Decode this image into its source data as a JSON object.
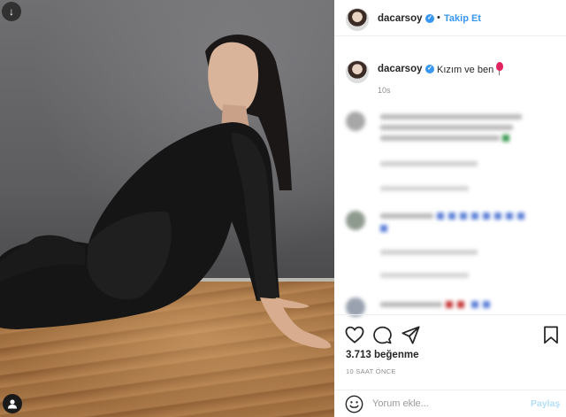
{
  "post": {
    "username": "dacarsoy",
    "follow_label": "Takip Et",
    "separator": "•"
  },
  "caption": {
    "username": "dacarsoy",
    "text": "Kızım ve ben",
    "time": "10s"
  },
  "stats": {
    "likes": "3.713 beğenme",
    "time": "10 SAAT ÖNCE"
  },
  "comment_box": {
    "placeholder": "Yorum ekle...",
    "submit_label": "Paylaş"
  },
  "icons": {
    "like": "heart-icon",
    "comment": "comment-icon",
    "share": "share-icon",
    "save": "bookmark-icon",
    "emoji": "emoji-icon",
    "verified": "verified-badge-icon"
  },
  "colors": {
    "accent": "#3897f0",
    "post_disabled": "#b2dffc",
    "muted": "#8e8e8e"
  }
}
